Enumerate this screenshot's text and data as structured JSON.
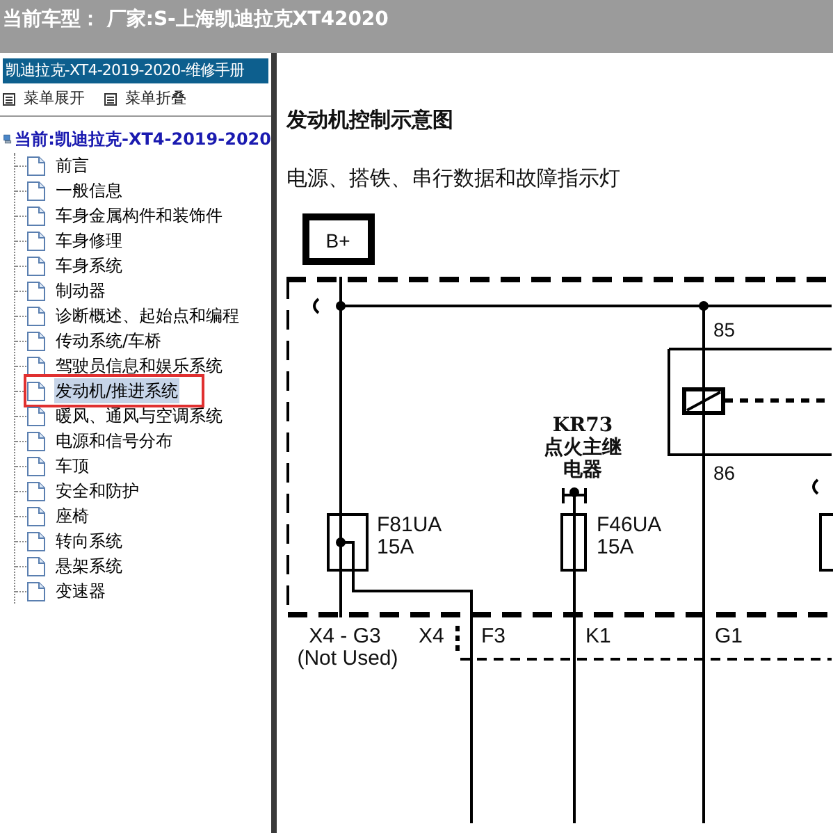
{
  "header": {
    "title": "当前车型： 厂家:S-上海凯迪拉克XT42020"
  },
  "sidebar": {
    "manual_title": "凯迪拉克-XT4-2019-2020-维修手册",
    "toolbar": [
      {
        "label": "菜单展开"
      },
      {
        "label": "菜单折叠"
      }
    ],
    "tree": {
      "label": "当前:凯迪拉克-XT4-2019-2020",
      "children": [
        {
          "label": "前言",
          "selected": false,
          "annotated": false
        },
        {
          "label": "一般信息",
          "selected": false,
          "annotated": false
        },
        {
          "label": "车身金属构件和装饰件",
          "selected": false,
          "annotated": false
        },
        {
          "label": "车身修理",
          "selected": false,
          "annotated": false
        },
        {
          "label": "车身系统",
          "selected": false,
          "annotated": false
        },
        {
          "label": "制动器",
          "selected": false,
          "annotated": false
        },
        {
          "label": "诊断概述、起始点和编程",
          "selected": false,
          "annotated": false
        },
        {
          "label": "传动系统/车桥",
          "selected": false,
          "annotated": false
        },
        {
          "label": "驾驶员信息和娱乐系统",
          "selected": false,
          "annotated": false
        },
        {
          "label": "发动机/推进系统",
          "selected": true,
          "annotated": true
        },
        {
          "label": "暖风、通风与空调系统",
          "selected": false,
          "annotated": false
        },
        {
          "label": "电源和信号分布",
          "selected": false,
          "annotated": false
        },
        {
          "label": "车顶",
          "selected": false,
          "annotated": false
        },
        {
          "label": "安全和防护",
          "selected": false,
          "annotated": false
        },
        {
          "label": "座椅",
          "selected": false,
          "annotated": false
        },
        {
          "label": "转向系统",
          "selected": false,
          "annotated": false
        },
        {
          "label": "悬架系统",
          "selected": false,
          "annotated": false
        },
        {
          "label": "变速器",
          "selected": false,
          "annotated": false
        }
      ]
    }
  },
  "content": {
    "heading": "发动机控制示意图",
    "subheading": "电源、搭铁、串行数据和故障指示灯",
    "diagram": {
      "power": "B+",
      "pin_85": "85",
      "pin_86": "86",
      "relay": [
        "KR73",
        "点火主继",
        "电器"
      ],
      "fuse_1": [
        "F81UA",
        "15A"
      ],
      "fuse_2": [
        "F46UA",
        "15A"
      ],
      "connectors": [
        "X4 - G3",
        "(Not Used)",
        "X4",
        "F3",
        "K1",
        "G1"
      ]
    }
  }
}
